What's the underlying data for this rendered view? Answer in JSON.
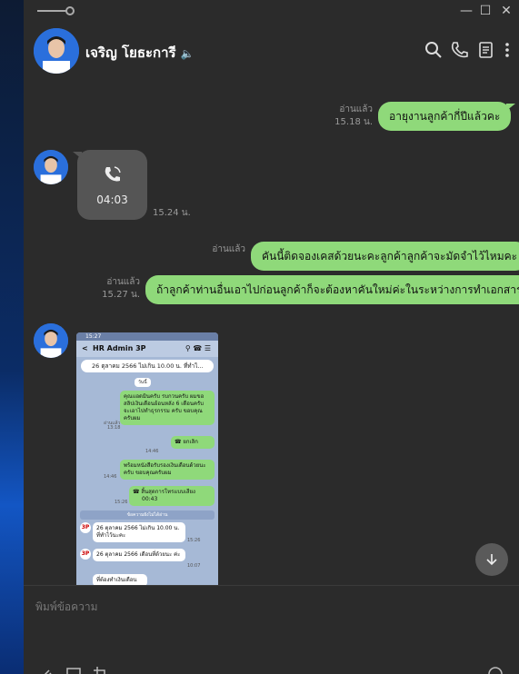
{
  "window": {
    "controls": {
      "minimize": "—",
      "maximize": "☐",
      "close": "✕"
    }
  },
  "header": {
    "contact_name": "เจริญ โยธะการี",
    "icons": [
      "speaker-icon",
      "search-icon",
      "phone-icon",
      "notes-icon",
      "more-icon"
    ]
  },
  "messages": [
    {
      "side": "out",
      "text": "อายุงานลูกค้ากี่ปีแล้วคะ",
      "read": "อ่านแล้ว",
      "time": "15.18 น."
    },
    {
      "side": "in",
      "type": "call",
      "duration": "04:03",
      "time": "15.24 น."
    },
    {
      "side": "out",
      "text": "คันนี้ติดจองเคสด้วยนะคะลูกค้าลูกค้าจะมัดจำไว้ไหมคะ",
      "read": "อ่านแล้ว"
    },
    {
      "side": "out",
      "text": "ถ้าลูกค้าท่านอื่นเอาไปก่อนลูกค้าก็จะต้องหาคันใหม่ค่ะในระหว่างการทำเอกสาร",
      "read": "อ่านแล้ว",
      "time": "15.27 น."
    }
  ],
  "image_message": {
    "status_time": "15:27",
    "chat_title": "HR Admin 3P",
    "announcement": "26 ตุลาคม 2566 ไม่เกิน 10.00 น. ที่ทำไ...",
    "day_label": "วันนี้",
    "bubble1": "คุณแอดมินครับ รบกวนครับ ผมขอสลิปเงินเดือนย้อนหลัง 6 เดือนครับ จะเอาไปทำธุรกรรม ครับ ขอบคุณครับผม",
    "bubble1_read": "อ่านแล้ว",
    "bubble1_time": "13:18",
    "bubble2": "ยกเลิก",
    "bubble2_time": "14:46",
    "bubble3": "พร้อมหนังสือรับรองเงินเดือนด้วยนะครับ ขอบคุณครับผม",
    "bubble3_time": "14:46",
    "bubble4": "สิ้นสุดการโทรแบบเสียง",
    "bubble4_dur": "00:43",
    "bubble4_time": "15:26",
    "divider": "ข้อความยังไม่ได้อ่าน",
    "msg1": "26 ตุลาคม 2566 ไม่เกิน 10.00 น. ที่ทำไว้นะคะ",
    "msg1_time": "15:26",
    "msg2": "26 ตุลาคม 2566 เดือนที่ด้วยนะ ค่ะ",
    "msg2_time": "10:07",
    "msg3": "ที่ต้องทำเงินเดือน"
  },
  "composer": {
    "placeholder": "พิมพ์ข้อความ"
  },
  "colors": {
    "window_bg": "#2b2b2b",
    "bubble_out": "#8fd97a",
    "bubble_in": "#555555",
    "meta_text": "#9a9a9a"
  }
}
